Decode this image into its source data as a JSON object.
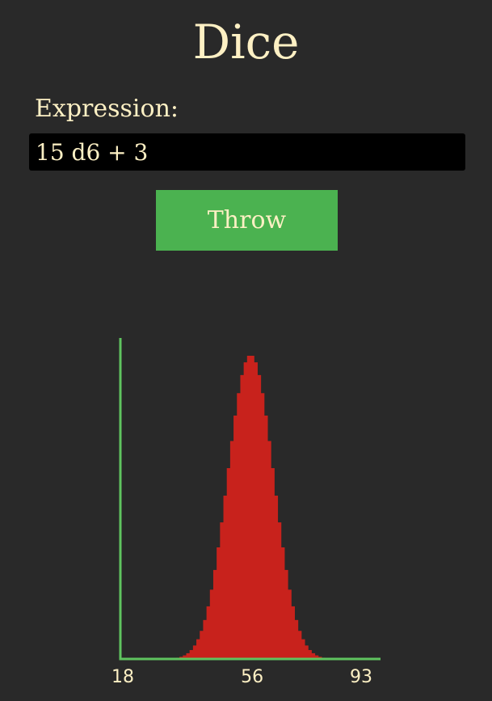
{
  "app": {
    "title": "Dice"
  },
  "expression": {
    "label": "Expression:",
    "value": "15 d6 + 3"
  },
  "throw_button": {
    "label": "Throw"
  },
  "colors": {
    "background": "#292929",
    "text": "#fdf0c4",
    "button": "#4bb250",
    "axis": "#5fc45f",
    "bars": "#c8221c"
  },
  "chart_data": {
    "type": "bar",
    "title": "",
    "xlabel": "",
    "ylabel": "",
    "distribution": "15d6 + 3",
    "xlim": [
      18,
      93
    ],
    "tick_labels": [
      "18",
      "56",
      "93"
    ],
    "tick_values": [
      18,
      56,
      93
    ],
    "grid": false,
    "legend": "none"
  }
}
